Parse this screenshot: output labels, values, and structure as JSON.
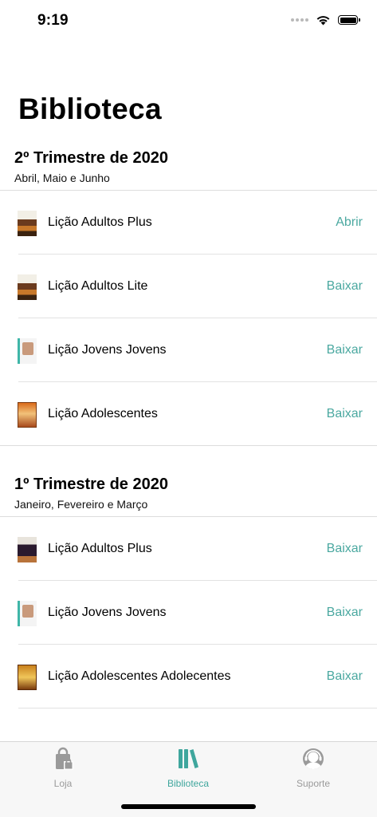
{
  "status_bar": {
    "time": "9:19"
  },
  "page": {
    "title": "Biblioteca"
  },
  "sections": [
    {
      "title": "2º Trimestre de 2020",
      "subtitle": "Abril, Maio e Junho",
      "items": [
        {
          "label": "Lição Adultos Plus",
          "action": "Abrir"
        },
        {
          "label": "Lição Adultos Lite",
          "action": "Baixar"
        },
        {
          "label": "Lição Jovens Jovens",
          "action": "Baixar"
        },
        {
          "label": "Lição Adolescentes",
          "action": "Baixar"
        }
      ]
    },
    {
      "title": "1º Trimestre de 2020",
      "subtitle": "Janeiro, Fevereiro e Março",
      "items": [
        {
          "label": "Lição Adultos Plus",
          "action": "Baixar"
        },
        {
          "label": "Lição Jovens Jovens",
          "action": "Baixar"
        },
        {
          "label": "Lição Adolescentes Adolecentes",
          "action": "Baixar"
        }
      ]
    }
  ],
  "tab_bar": {
    "tabs": [
      {
        "label": "Loja",
        "icon": "shopping-bag-icon",
        "active": false
      },
      {
        "label": "Biblioteca",
        "icon": "books-icon",
        "active": true
      },
      {
        "label": "Suporte",
        "icon": "support-headset-icon",
        "active": false
      }
    ]
  },
  "colors": {
    "accent": "#4aa8a0",
    "inactive": "#9a9a9a"
  }
}
